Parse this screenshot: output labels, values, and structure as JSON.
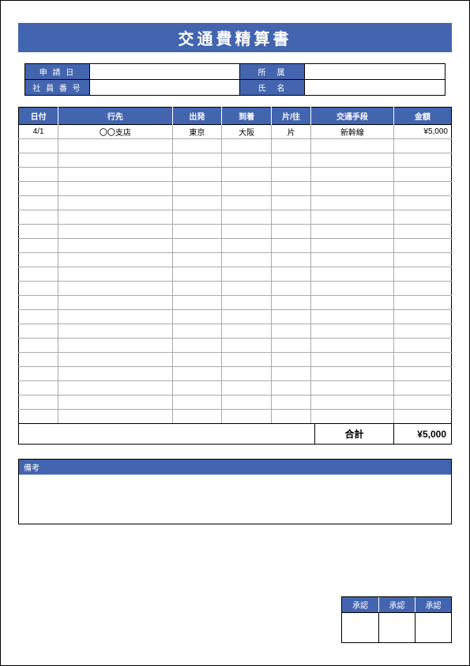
{
  "title": "交通費精算書",
  "info": {
    "labels": {
      "application_date": "申 請 日",
      "department": "所　属",
      "employee_number": "社 員 番 号",
      "name": "氏　名"
    },
    "values": {
      "application_date": "",
      "department": "",
      "employee_number": "",
      "name": ""
    }
  },
  "table": {
    "headers": {
      "date": "日付",
      "destination": "行先",
      "departure": "出発",
      "arrival": "到着",
      "oneway_round": "片/往",
      "transport": "交通手段",
      "amount": "金額"
    },
    "rows": [
      {
        "date": "4/1",
        "destination": "〇〇支店",
        "departure": "東京",
        "arrival": "大阪",
        "oneway_round": "片",
        "transport": "新幹線",
        "amount": "¥5,000"
      },
      {
        "date": "",
        "destination": "",
        "departure": "",
        "arrival": "",
        "oneway_round": "",
        "transport": "",
        "amount": ""
      },
      {
        "date": "",
        "destination": "",
        "departure": "",
        "arrival": "",
        "oneway_round": "",
        "transport": "",
        "amount": ""
      },
      {
        "date": "",
        "destination": "",
        "departure": "",
        "arrival": "",
        "oneway_round": "",
        "transport": "",
        "amount": ""
      },
      {
        "date": "",
        "destination": "",
        "departure": "",
        "arrival": "",
        "oneway_round": "",
        "transport": "",
        "amount": ""
      },
      {
        "date": "",
        "destination": "",
        "departure": "",
        "arrival": "",
        "oneway_round": "",
        "transport": "",
        "amount": ""
      },
      {
        "date": "",
        "destination": "",
        "departure": "",
        "arrival": "",
        "oneway_round": "",
        "transport": "",
        "amount": ""
      },
      {
        "date": "",
        "destination": "",
        "departure": "",
        "arrival": "",
        "oneway_round": "",
        "transport": "",
        "amount": ""
      },
      {
        "date": "",
        "destination": "",
        "departure": "",
        "arrival": "",
        "oneway_round": "",
        "transport": "",
        "amount": ""
      },
      {
        "date": "",
        "destination": "",
        "departure": "",
        "arrival": "",
        "oneway_round": "",
        "transport": "",
        "amount": ""
      },
      {
        "date": "",
        "destination": "",
        "departure": "",
        "arrival": "",
        "oneway_round": "",
        "transport": "",
        "amount": ""
      },
      {
        "date": "",
        "destination": "",
        "departure": "",
        "arrival": "",
        "oneway_round": "",
        "transport": "",
        "amount": ""
      },
      {
        "date": "",
        "destination": "",
        "departure": "",
        "arrival": "",
        "oneway_round": "",
        "transport": "",
        "amount": ""
      },
      {
        "date": "",
        "destination": "",
        "departure": "",
        "arrival": "",
        "oneway_round": "",
        "transport": "",
        "amount": ""
      },
      {
        "date": "",
        "destination": "",
        "departure": "",
        "arrival": "",
        "oneway_round": "",
        "transport": "",
        "amount": ""
      },
      {
        "date": "",
        "destination": "",
        "departure": "",
        "arrival": "",
        "oneway_round": "",
        "transport": "",
        "amount": ""
      },
      {
        "date": "",
        "destination": "",
        "departure": "",
        "arrival": "",
        "oneway_round": "",
        "transport": "",
        "amount": ""
      },
      {
        "date": "",
        "destination": "",
        "departure": "",
        "arrival": "",
        "oneway_round": "",
        "transport": "",
        "amount": ""
      },
      {
        "date": "",
        "destination": "",
        "departure": "",
        "arrival": "",
        "oneway_round": "",
        "transport": "",
        "amount": ""
      },
      {
        "date": "",
        "destination": "",
        "departure": "",
        "arrival": "",
        "oneway_round": "",
        "transport": "",
        "amount": ""
      },
      {
        "date": "",
        "destination": "",
        "departure": "",
        "arrival": "",
        "oneway_round": "",
        "transport": "",
        "amount": ""
      }
    ]
  },
  "total": {
    "label": "合計",
    "value": "¥5,000"
  },
  "remarks": {
    "label": "備考",
    "value": ""
  },
  "approval": {
    "headers": [
      "承認",
      "承認",
      "承認"
    ]
  }
}
